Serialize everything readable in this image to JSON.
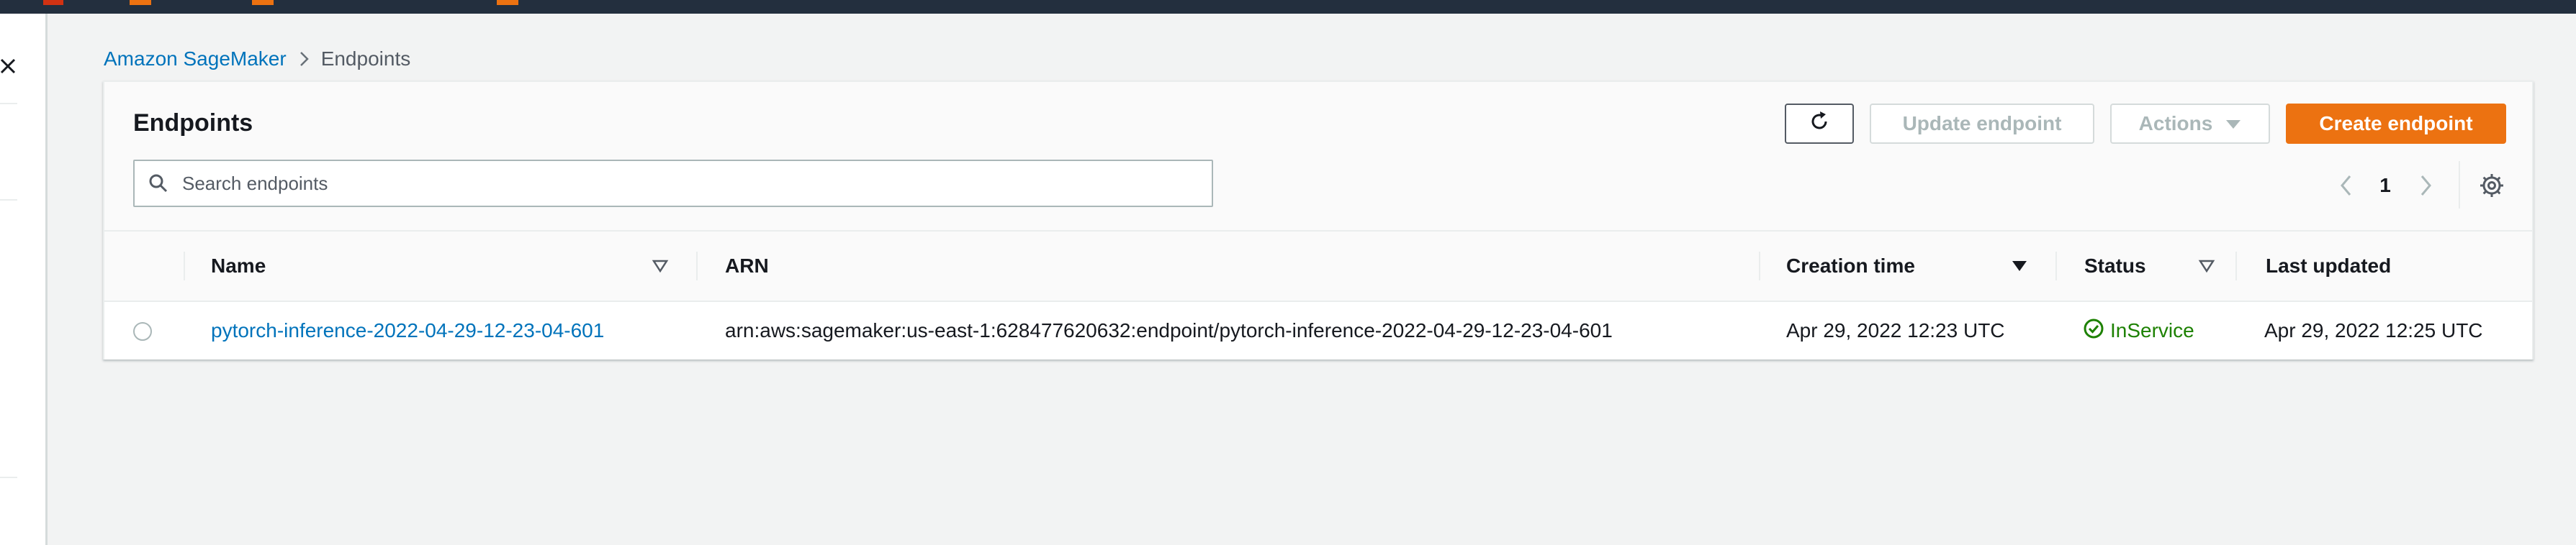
{
  "breadcrumb": {
    "service": "Amazon SageMaker",
    "current": "Endpoints"
  },
  "table": {
    "title": "Endpoints",
    "buttons": {
      "update": "Update endpoint",
      "actions": "Actions",
      "create": "Create endpoint"
    },
    "search": {
      "placeholder": "Search endpoints",
      "value": ""
    },
    "pagination": {
      "current_page": "1"
    },
    "columns": [
      "Name",
      "ARN",
      "Creation time",
      "Status",
      "Last updated"
    ],
    "rows": [
      {
        "name": "pytorch-inference-2022-04-29-12-23-04-601",
        "arn": "arn:aws:sagemaker:us-east-1:628477620632:endpoint/pytorch-inference-2022-04-29-12-23-04-601",
        "creation_time": "Apr 29, 2022 12:23 UTC",
        "status": "InService",
        "last_updated": "Apr 29, 2022 12:25 UTC",
        "selected": false
      }
    ]
  },
  "icons": {
    "close": "close-icon",
    "breadcrumb_separator": "chevron-right-icon",
    "refresh": "refresh-icon",
    "actions_caret": "caret-down-icon",
    "search": "search-icon",
    "prev_page": "chevron-left-icon",
    "next_page": "chevron-right-icon",
    "settings": "gear-icon",
    "sort": "caret-down-outline-icon",
    "sort_active": "caret-down-filled-icon",
    "status": "check-circle-icon"
  },
  "colors": {
    "link": "#0073bb",
    "primary_button": "#ec7211",
    "success": "#1d8102",
    "top_nav": "#232f3e"
  }
}
